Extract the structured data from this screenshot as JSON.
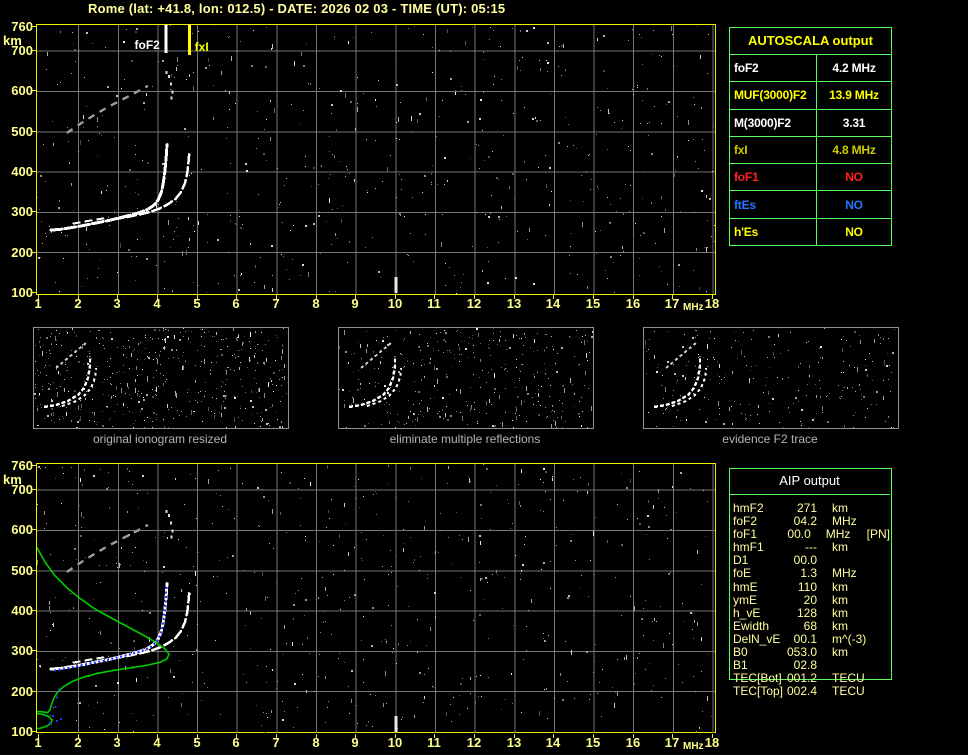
{
  "title": "Rome (lat: +41.8, lon: 012.5) - DATE: 2026 02 03 - TIME (UT): 05:15",
  "colors": {
    "title_text": "#ffff9e",
    "axis_text": "#ffff8c",
    "plot_border": "#f0f000",
    "grid": "#757575",
    "table_border": "#55ff55",
    "profile_green": "#00cc00",
    "fit_blue": "#2236ff",
    "trace_white": "#ffffff",
    "second_hop_gray": "#9a9a9a"
  },
  "axes": {
    "x_ticks": [
      1,
      2,
      3,
      4,
      5,
      6,
      7,
      8,
      9,
      10,
      11,
      12,
      13,
      14,
      15,
      16,
      17,
      18
    ],
    "x_unit": "MHz",
    "y_ticks": [
      760,
      700,
      600,
      500,
      400,
      300,
      200,
      100
    ],
    "y_unit": "km"
  },
  "top_plot": {
    "markers": [
      {
        "label": "foF2",
        "mhz": 4.2,
        "color": "#ffffff"
      },
      {
        "label": "fxI",
        "mhz": 4.8,
        "color": "#ffff00"
      }
    ]
  },
  "autoscala_table": {
    "header": "AUTOSCALA output",
    "rows": [
      {
        "label": "foF2",
        "value": "4.2 MHz",
        "color": "#ffffff"
      },
      {
        "label": "MUF(3000)F2",
        "value": "13.9 MHz",
        "color": "#ffff00"
      },
      {
        "label": "M(3000)F2",
        "value": "3.31",
        "color": "#ffffff"
      },
      {
        "label": "fxI",
        "value": "4.8 MHz",
        "color": "#cccc00"
      },
      {
        "label": "foF1",
        "value": "NO",
        "color": "#ff2222"
      },
      {
        "label": "ftEs",
        "value": "NO",
        "color": "#2277ff"
      },
      {
        "label": "h'Es",
        "value": "NO",
        "color": "#ffff00"
      }
    ]
  },
  "panels": [
    {
      "caption": "original ionogram resized"
    },
    {
      "caption": "eliminate multiple reflections"
    },
    {
      "caption": "evidence F2 trace"
    }
  ],
  "aip_table": {
    "header": "AIP output",
    "rows": [
      {
        "name": "hmF2",
        "value": "271",
        "unit": "km",
        "extra": ""
      },
      {
        "name": "foF2",
        "value": "04.2",
        "unit": "MHz",
        "extra": ""
      },
      {
        "name": "foF1",
        "value": "00.0",
        "unit": "MHz",
        "extra": "[PN]"
      },
      {
        "name": "hmF1",
        "value": "---",
        "unit": "km",
        "extra": ""
      },
      {
        "name": "D1",
        "value": "00.0",
        "unit": "",
        "extra": ""
      },
      {
        "name": "foE",
        "value": "1.3",
        "unit": "MHz",
        "extra": ""
      },
      {
        "name": "hmE",
        "value": "110",
        "unit": "km",
        "extra": ""
      },
      {
        "name": "ymE",
        "value": "20",
        "unit": "km",
        "extra": ""
      },
      {
        "name": "h_vE",
        "value": "128",
        "unit": "km",
        "extra": ""
      },
      {
        "name": "Ewidth",
        "value": "68",
        "unit": "km",
        "extra": ""
      },
      {
        "name": "DelN_vE",
        "value": "00.1",
        "unit": "m^(-3)",
        "extra": ""
      },
      {
        "name": "B0",
        "value": "053.0",
        "unit": "km",
        "extra": ""
      },
      {
        "name": "B1",
        "value": "02.8",
        "unit": "",
        "extra": ""
      },
      {
        "name": "TEC[Bot]",
        "value": "001.2",
        "unit": "TECU",
        "extra": ""
      },
      {
        "name": "TEC[Top]",
        "value": "002.4",
        "unit": "TECU",
        "extra": ""
      }
    ]
  },
  "chart_data": {
    "type": "scatter",
    "title": "Ionogram, Rome 2026-02-03 05:15 UT",
    "xlabel": "MHz",
    "ylabel": "km",
    "xlim": [
      1,
      18
    ],
    "ylim": [
      100,
      765
    ],
    "grid": true,
    "scaled_values": {
      "foF2_MHz": 4.2,
      "fxI_MHz": 4.8,
      "MUF3000F2_MHz": 13.9,
      "M3000F2": 3.31,
      "hmF2_km": 271
    },
    "traces": {
      "o_main": [
        [
          1.3,
          256
        ],
        [
          1.55,
          258
        ],
        [
          1.8,
          262
        ],
        [
          2.05,
          266
        ],
        [
          2.3,
          271
        ],
        [
          2.55,
          276
        ],
        [
          2.8,
          281
        ],
        [
          3.05,
          287
        ],
        [
          3.3,
          293
        ],
        [
          3.55,
          300
        ],
        [
          3.75,
          308
        ],
        [
          3.9,
          318
        ],
        [
          4.0,
          330
        ],
        [
          4.08,
          348
        ],
        [
          4.13,
          370
        ],
        [
          4.17,
          398
        ],
        [
          4.2,
          428
        ],
        [
          4.22,
          455
        ],
        [
          4.23,
          468
        ]
      ],
      "fork": [
        [
          1.85,
          272
        ],
        [
          2.3,
          280
        ],
        [
          2.75,
          287
        ]
      ],
      "x_mode": [
        [
          2.9,
          283
        ],
        [
          3.2,
          288
        ],
        [
          3.5,
          294
        ],
        [
          3.8,
          301
        ],
        [
          4.05,
          310
        ],
        [
          4.25,
          320
        ],
        [
          4.45,
          334
        ],
        [
          4.58,
          350
        ],
        [
          4.68,
          372
        ],
        [
          4.74,
          398
        ],
        [
          4.77,
          425
        ],
        [
          4.79,
          448
        ]
      ],
      "second_hop": [
        [
          1.7,
          497
        ],
        [
          2.05,
          520
        ],
        [
          2.4,
          542
        ],
        [
          2.75,
          562
        ],
        [
          3.1,
          580
        ],
        [
          3.45,
          598
        ],
        [
          3.75,
          614
        ]
      ],
      "echo_dots": [
        [
          4.28,
          638
        ],
        [
          4.33,
          620
        ],
        [
          4.37,
          600
        ],
        [
          4.34,
          585
        ],
        [
          4.22,
          648
        ]
      ],
      "profile": [
        [
          0.95,
          558
        ],
        [
          1.15,
          522
        ],
        [
          1.4,
          488
        ],
        [
          1.7,
          458
        ],
        [
          2.0,
          434
        ],
        [
          2.4,
          406
        ],
        [
          2.8,
          384
        ],
        [
          3.2,
          363
        ],
        [
          3.6,
          342
        ],
        [
          3.95,
          322
        ],
        [
          4.18,
          306
        ],
        [
          4.28,
          293
        ],
        [
          4.22,
          281
        ],
        [
          4.05,
          273
        ],
        [
          3.7,
          265
        ],
        [
          3.3,
          259
        ],
        [
          2.9,
          253
        ],
        [
          2.5,
          246
        ],
        [
          2.15,
          237
        ],
        [
          1.85,
          226
        ],
        [
          1.62,
          213
        ],
        [
          1.47,
          199
        ],
        [
          1.38,
          185
        ],
        [
          1.32,
          170
        ],
        [
          1.28,
          156
        ],
        [
          1.22,
          148
        ],
        [
          1.1,
          150
        ],
        [
          0.95,
          151
        ]
      ],
      "e_loop": [
        [
          0.95,
          146
        ],
        [
          1.12,
          143
        ],
        [
          1.25,
          138
        ],
        [
          1.33,
          130
        ],
        [
          1.3,
          121
        ],
        [
          1.18,
          114
        ],
        [
          1.05,
          110
        ],
        [
          0.96,
          108
        ]
      ],
      "blue_trace": [
        [
          1.38,
          252
        ],
        [
          1.6,
          256
        ],
        [
          1.85,
          261
        ],
        [
          2.1,
          266
        ],
        [
          2.35,
          271
        ],
        [
          2.6,
          276
        ],
        [
          2.85,
          282
        ],
        [
          3.1,
          288
        ],
        [
          3.35,
          294
        ],
        [
          3.6,
          301
        ],
        [
          3.8,
          310
        ],
        [
          3.95,
          322
        ],
        [
          4.05,
          338
        ],
        [
          4.11,
          358
        ],
        [
          4.15,
          382
        ],
        [
          4.18,
          410
        ],
        [
          4.2,
          438
        ],
        [
          4.21,
          460
        ]
      ],
      "blue_stray": [
        [
          1.5,
          205
        ],
        [
          1.45,
          185
        ],
        [
          1.42,
          162
        ],
        [
          1.35,
          140
        ],
        [
          1.28,
          122
        ],
        [
          1.45,
          127
        ],
        [
          1.55,
          132
        ]
      ]
    },
    "panel_trace": {
      "streak": [
        [
          22,
          40
        ],
        [
          34,
          30
        ],
        [
          46,
          20
        ],
        [
          52,
          15
        ]
      ],
      "main": [
        [
          10,
          79
        ],
        [
          22,
          77
        ],
        [
          34,
          73
        ],
        [
          44,
          67
        ],
        [
          50,
          60
        ],
        [
          54,
          50
        ],
        [
          56,
          38
        ],
        [
          56,
          28
        ]
      ],
      "xbranch": [
        [
          28,
          78
        ],
        [
          40,
          74
        ],
        [
          50,
          68
        ],
        [
          57,
          60
        ],
        [
          61,
          50
        ],
        [
          62,
          40
        ]
      ]
    }
  }
}
